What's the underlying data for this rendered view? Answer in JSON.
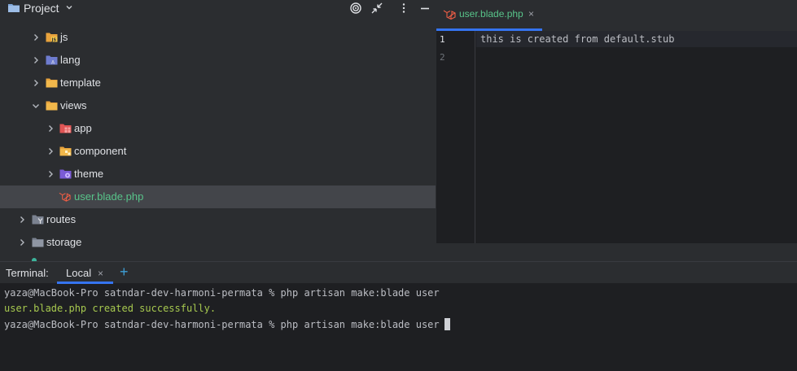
{
  "project_panel": {
    "title": "Project",
    "tree": [
      {
        "label": "js",
        "icon": "js-folder-icon",
        "expanded": false
      },
      {
        "label": "lang",
        "icon": "lang-folder-icon",
        "expanded": false
      },
      {
        "label": "template",
        "icon": "folder-icon",
        "expanded": false
      },
      {
        "label": "views",
        "icon": "folder-icon",
        "expanded": true
      },
      {
        "label": "app",
        "icon": "app-folder-icon",
        "expanded": false
      },
      {
        "label": "component",
        "icon": "component-folder-icon",
        "expanded": false
      },
      {
        "label": "theme",
        "icon": "theme-folder-icon",
        "expanded": false
      },
      {
        "label": "user.blade.php",
        "icon": "laravel-file-icon",
        "selected": true
      },
      {
        "label": "routes",
        "icon": "routes-folder-icon",
        "expanded": false
      },
      {
        "label": "storage",
        "icon": "folder-icon",
        "expanded": false
      }
    ]
  },
  "editor": {
    "tab": {
      "label": "user.blade.php",
      "close": "×"
    },
    "line_numbers": [
      "1",
      "2"
    ],
    "lines": [
      "this is created from default.stub",
      ""
    ]
  },
  "terminal": {
    "title": "Terminal:",
    "tab": {
      "label": "Local",
      "close": "×"
    },
    "add": "+",
    "lines": [
      "yaza@MacBook-Pro satndar-dev-harmoni-permata % php artisan make:blade user",
      "user.blade.php created successfully.",
      "yaza@MacBook-Pro satndar-dev-harmoni-permata % php artisan make:blade user"
    ]
  },
  "colors": {
    "accent": "#3574f0",
    "file_green": "#58c48a",
    "success_green": "#a7c94f",
    "panel_bg": "#2b2d30",
    "editor_bg": "#1e1f22"
  }
}
